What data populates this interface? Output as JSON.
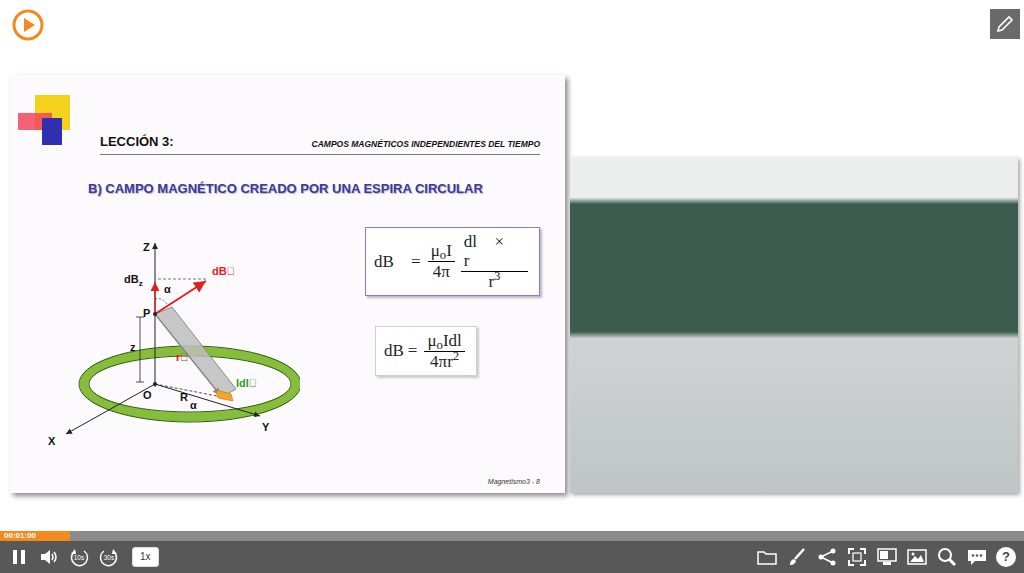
{
  "slide": {
    "lesson": "LECCIÓN 3:",
    "topic": "CAMPOS MAGNÉTICOS INDEPENDIENTES DEL TIEMPO",
    "title": "B) CAMPO MAGNÉTICO CREADO POR UNA ESPIRA CIRCULAR",
    "diagram_labels": [
      {
        "text": "Z",
        "color": "#111111"
      },
      {
        "text": "dB",
        "sub": "z",
        "color": "#111111"
      },
      {
        "text": "α",
        "color": "#111111"
      },
      {
        "text": "dB⃗",
        "color": "#e02020"
      },
      {
        "text": "P",
        "color": "#111111"
      },
      {
        "text": "z",
        "color": "#111111"
      },
      {
        "text": "r⃗",
        "color": "#e02020"
      },
      {
        "text": "O",
        "color": "#111111"
      },
      {
        "text": "R",
        "color": "#111111"
      },
      {
        "text": "α",
        "color": "#111111"
      },
      {
        "text": "Idl⃗",
        "color": "#2aa02a"
      },
      {
        "text": "X",
        "color": "#111111"
      },
      {
        "text": "Y",
        "color": "#111111"
      }
    ],
    "formulas": [
      {
        "lhs": "dB⃗",
        "eq": "=",
        "fractions": [
          {
            "num": [
              {
                "text": "μ",
                "kind": "text"
              },
              {
                "text": "o",
                "kind": "sub"
              },
              {
                "text": "I",
                "kind": "text"
              }
            ],
            "den": [
              {
                "text": "4π",
                "kind": "text"
              }
            ]
          },
          {
            "num": [
              {
                "text": "dl⃗ × r⃗",
                "kind": "text"
              }
            ],
            "den": [
              {
                "text": "r",
                "kind": "text"
              },
              {
                "text": "3",
                "kind": "sup"
              }
            ]
          }
        ]
      },
      {
        "lhs": "dB",
        "eq": "=",
        "fractions": [
          {
            "num": [
              {
                "text": "μ",
                "kind": "text"
              },
              {
                "text": "o",
                "kind": "sub"
              },
              {
                "text": "Idl",
                "kind": "text"
              }
            ],
            "den": [
              {
                "text": "4πr",
                "kind": "text"
              },
              {
                "text": "2",
                "kind": "sup"
              }
            ]
          }
        ]
      }
    ],
    "footer": "Magnetismo3 - 8"
  },
  "progress": {
    "time": "00:01:00",
    "level": 0.068
  },
  "controls": {
    "playing": true,
    "rewind": "10s",
    "forward": "30s",
    "speed": "1x",
    "help": "?"
  }
}
